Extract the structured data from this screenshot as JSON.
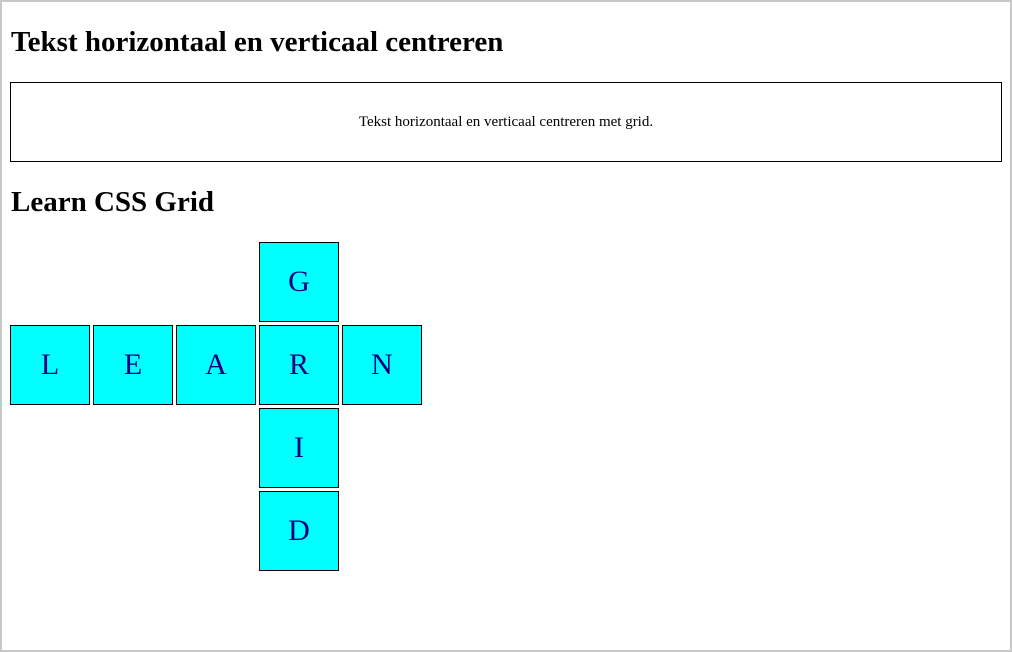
{
  "page": {
    "title": "Tekst horizontaal en verticaal centreren"
  },
  "center_demo": {
    "text": "Tekst horizontaal en verticaal centreren met grid."
  },
  "grid_section": {
    "title": "Learn CSS Grid"
  },
  "grid_letters": {
    "g": "G",
    "l": "L",
    "e": "E",
    "a": "A",
    "r": "R",
    "n": "N",
    "i": "I",
    "d": "D"
  },
  "colors": {
    "cell_background": "#00ffff",
    "cell_text": "#000080",
    "border": "#000000",
    "frame_border": "#c8c8c8"
  }
}
